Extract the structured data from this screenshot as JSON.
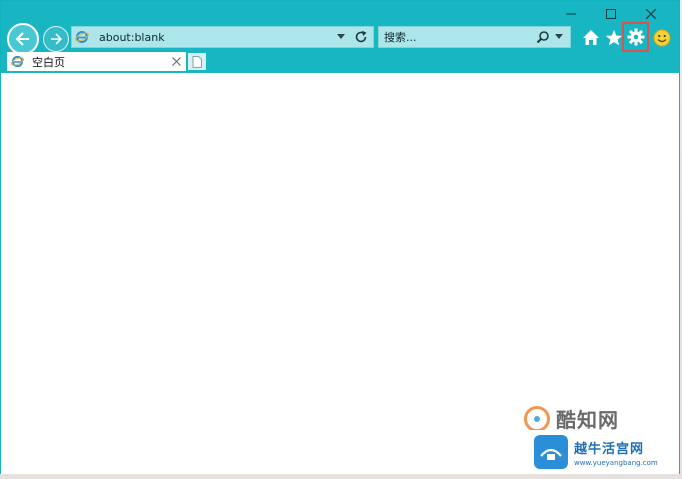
{
  "window": {
    "caption": {
      "minimize": "–",
      "maximize": "☐",
      "close": "✕"
    }
  },
  "address_bar": {
    "url": "about:blank"
  },
  "search_bar": {
    "placeholder": "搜索..."
  },
  "tabs": [
    {
      "title": "空白页",
      "close": "×"
    }
  ],
  "watermark": {
    "brand1": "酷知网",
    "brand2": "越牛活宫网",
    "url2": "www.yueyangbang.com"
  },
  "colors": {
    "chrome": "#18b6c2",
    "field": "#ace6ea",
    "highlight_box": "#d9534f"
  },
  "icons": [
    "back-icon",
    "forward-icon",
    "ie-icon",
    "dropdown-icon",
    "refresh-icon",
    "search-icon",
    "home-icon",
    "favorites-icon",
    "gear-icon",
    "smiley-icon",
    "new-tab-icon"
  ]
}
